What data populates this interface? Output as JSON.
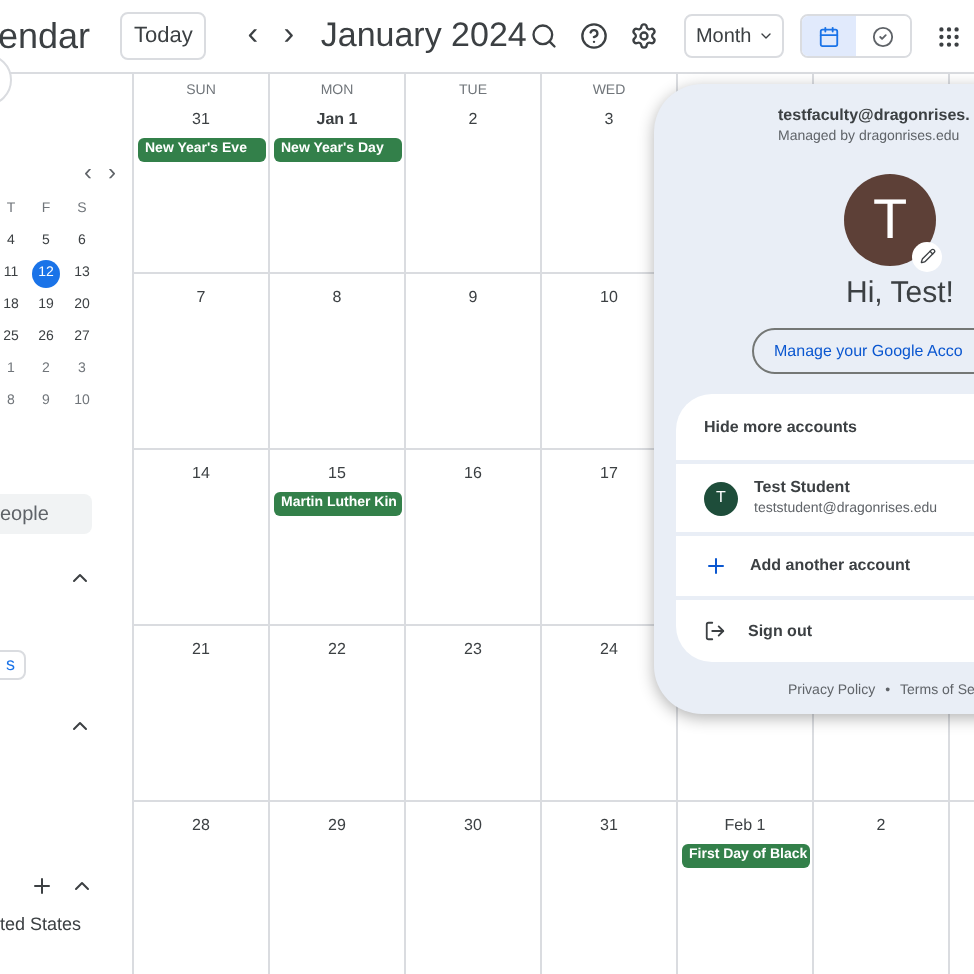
{
  "header": {
    "app_title": "endar",
    "today_button": "Today",
    "prev": "‹",
    "next": "›",
    "period": "January 2024",
    "view": "Month",
    "view_toggle": [
      {
        "kind": "calendar",
        "selected": true
      },
      {
        "kind": "tasks",
        "selected": false
      }
    ]
  },
  "sidebar": {
    "mini_calendar": {
      "prev": "‹",
      "next": "›",
      "weekdays": [
        "T",
        "F",
        "S"
      ],
      "weeks": [
        [
          {
            "day": "4",
            "selected": false
          },
          {
            "day": "5",
            "selected": false
          },
          {
            "day": "6",
            "selected": false
          }
        ],
        [
          {
            "day": "11",
            "selected": false
          },
          {
            "day": "12",
            "selected": true
          },
          {
            "day": "13",
            "selected": false
          }
        ],
        [
          {
            "day": "18",
            "selected": false
          },
          {
            "day": "19",
            "selected": false
          },
          {
            "day": "20",
            "selected": false
          }
        ],
        [
          {
            "day": "25",
            "selected": false
          },
          {
            "day": "26",
            "selected": false
          },
          {
            "day": "27",
            "selected": false
          }
        ],
        [
          {
            "day": "1",
            "selected": false
          },
          {
            "day": "2",
            "selected": false
          },
          {
            "day": "3",
            "selected": false
          }
        ],
        [
          {
            "day": "8",
            "selected": false
          },
          {
            "day": "9",
            "selected": false
          },
          {
            "day": "10",
            "selected": false
          }
        ]
      ]
    },
    "search": {
      "placeholder": "eople"
    },
    "section_button": "s",
    "region_label": "ted States"
  },
  "calendar": {
    "weekdays": [
      "SUN",
      "MON",
      "TUE",
      "WED"
    ],
    "weeks": [
      {
        "days": [
          {
            "date": "31",
            "today": false,
            "events": [
              "New Year's Eve"
            ]
          },
          {
            "date": "Jan 1",
            "today": true,
            "events": [
              "New Year's Day"
            ]
          },
          {
            "date": "2",
            "today": false
          },
          {
            "date": "3",
            "today": false
          }
        ]
      },
      {
        "days": [
          {
            "date": "7",
            "today": false
          },
          {
            "date": "8",
            "today": false
          },
          {
            "date": "9",
            "today": false
          },
          {
            "date": "10",
            "today": false
          }
        ]
      },
      {
        "days": [
          {
            "date": "14",
            "today": false
          },
          {
            "date": "15",
            "today": false,
            "events": [
              "Martin Luther Kin"
            ]
          },
          {
            "date": "16",
            "today": false
          },
          {
            "date": "17",
            "today": false
          }
        ]
      },
      {
        "days": [
          {
            "date": "21",
            "today": false
          },
          {
            "date": "22",
            "today": false
          },
          {
            "date": "23",
            "today": false
          },
          {
            "date": "24",
            "today": false
          }
        ]
      },
      {
        "days": [
          {
            "date": "28",
            "today": false
          },
          {
            "date": "29",
            "today": false
          },
          {
            "date": "30",
            "today": false
          },
          {
            "date": "31",
            "today": false
          },
          {
            "date": "Feb 1",
            "today": false,
            "events": [
              "First Day of Black"
            ]
          },
          {
            "date": "2",
            "today": false
          }
        ]
      }
    ]
  },
  "account_popup": {
    "email": "testfaculty@dragonrises.",
    "managed_by": "Managed by dragonrises.edu",
    "avatar_letter": "T",
    "greeting": "Hi, Test!",
    "manage_button": "Manage your Google Acco",
    "accounts_toggle": "Hide more accounts",
    "other_accounts": [
      {
        "letter": "T",
        "name": "Test Student",
        "email": "teststudent@dragonrises.edu"
      }
    ],
    "add_account": "Add another account",
    "sign_out": "Sign out",
    "privacy": "Privacy Policy",
    "separator": "•",
    "terms": "Terms of Se"
  }
}
